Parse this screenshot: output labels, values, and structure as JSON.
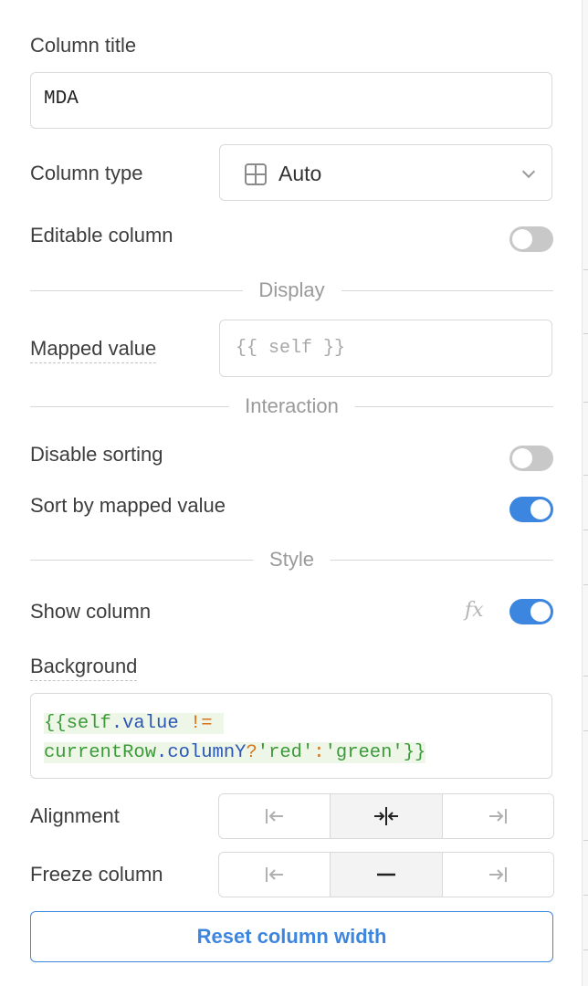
{
  "column_title": {
    "label": "Column title",
    "value": "MDA"
  },
  "column_type": {
    "label": "Column type",
    "selected": "Auto",
    "icon": "grid-icon"
  },
  "editable_column": {
    "label": "Editable column",
    "enabled": false
  },
  "sections": {
    "display": "Display",
    "interaction": "Interaction",
    "style": "Style"
  },
  "mapped_value": {
    "label": "Mapped value",
    "placeholder": "{{ self }}"
  },
  "disable_sorting": {
    "label": "Disable sorting",
    "enabled": false
  },
  "sort_by_mapped": {
    "label": "Sort by mapped value",
    "enabled": true
  },
  "show_column": {
    "label": "Show column",
    "fx": "fx",
    "enabled": true
  },
  "background": {
    "label": "Background",
    "code": {
      "open": "{{",
      "self": "self",
      "dot_value": ".value",
      "neq": " !=",
      "current_row": "currentRow",
      "dot_col": ".columnY",
      "q": "?",
      "red": "'red'",
      "colon": ":",
      "green": "'green'",
      "close": "}}"
    }
  },
  "alignment": {
    "label": "Alignment",
    "options": [
      "align-left",
      "align-center",
      "align-right"
    ],
    "selected": 1
  },
  "freeze_column": {
    "label": "Freeze column",
    "options": [
      "freeze-left",
      "freeze-none",
      "freeze-right"
    ],
    "selected": 1
  },
  "reset_button": "Reset column width",
  "colors": {
    "accent": "#3d86e0",
    "toggle_off": "#c8c8c8"
  }
}
